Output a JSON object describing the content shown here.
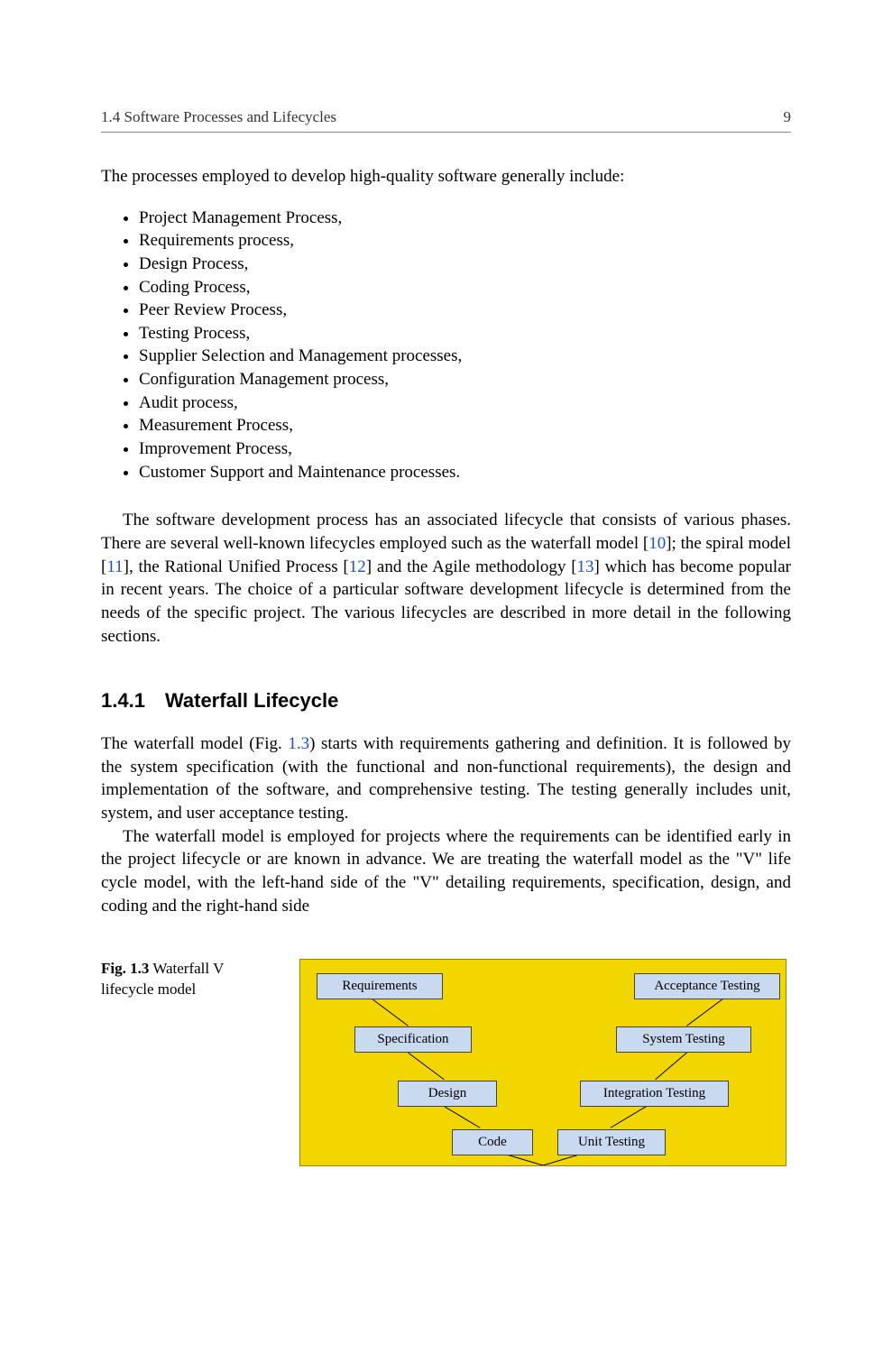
{
  "header": {
    "section_label": "1.4   Software Processes and Lifecycles",
    "page_number": "9"
  },
  "intro_text": "The processes employed to develop high-quality software generally include:",
  "process_list": [
    "Project Management Process,",
    "Requirements process,",
    "Design Process,",
    "Coding Process,",
    "Peer Review Process,",
    "Testing Process,",
    "Supplier Selection and Management processes,",
    "Configuration Management process,",
    "Audit process,",
    "Measurement Process,",
    "Improvement Process,",
    "Customer Support and Maintenance processes."
  ],
  "para1": {
    "t1": "The software development process has an associated lifecycle that consists of various phases. There are several well-known lifecycles employed such as the waterfall model [",
    "r1": "10",
    "t2": "]; the spiral model [",
    "r2": "11",
    "t3": "], the Rational Unified Process [",
    "r3": "12",
    "t4": "] and the Agile methodology [",
    "r4": "13",
    "t5": "] which has become popular in recent years. The choice of a particular software development lifecycle is determined from the needs of the specific project. The various lifecycles are described in more detail in the following sections."
  },
  "subsection": {
    "number": "1.4.1",
    "title": "Waterfall Lifecycle"
  },
  "para2": {
    "t1": "The waterfall model (Fig. ",
    "figref": "1.3",
    "t2": ") starts with requirements gathering and definition. It is followed by the system specification (with the functional and non-functional requirements), the design and implementation of the software, and comprehensive testing. The testing generally includes unit, system, and user acceptance testing."
  },
  "para3": "The waterfall model is employed for projects where the requirements can be identified early in the project lifecycle or are known in advance. We are treating the waterfall model as the \"V\" life cycle model, with the left-hand side of the \"V\" detailing requirements, specification, design, and coding and the right-hand side",
  "figure": {
    "number": "Fig. 1.3",
    "caption": "Waterfall V lifecycle model",
    "boxes": {
      "requirements": "Requirements",
      "specification": "Specification",
      "design": "Design",
      "code": "Code",
      "unit_testing": "Unit Testing",
      "integration_testing": "Integration Testing",
      "system_testing": "System Testing",
      "acceptance_testing": "Acceptance Testing"
    }
  }
}
